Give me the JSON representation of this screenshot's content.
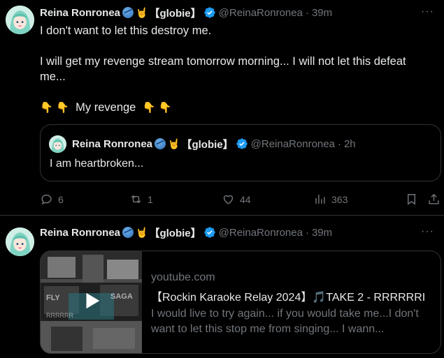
{
  "tweets": [
    {
      "author_name": "Reina Ronronea",
      "author_tag": "【globie】",
      "handle": "@ReinaRonronea",
      "time_sep": "·",
      "time": "39m",
      "text_lines": [
        "I don't want to let this destroy me.",
        "I will get my revenge stream tomorrow morning... I will not let this defeat",
        "me..."
      ],
      "revenge_text": "My revenge",
      "quote": {
        "author_name": "Reina Ronronea",
        "author_tag": "【globie】",
        "handle": "@ReinaRonronea",
        "time_sep": "·",
        "time": "2h",
        "text": "I am heartbroken..."
      },
      "actions": {
        "replies": "6",
        "retweets": "1",
        "likes": "44",
        "views": "363"
      }
    },
    {
      "author_name": "Reina Ronronea",
      "author_tag": "【globie】",
      "handle": "@ReinaRonronea",
      "time_sep": "·",
      "time": "39m",
      "card": {
        "domain": "youtube.com",
        "title": "【Rockin Karaoke Relay 2024】🎵TAKE 2 - RRRRRRI",
        "description": "I would live to try again... if you would take me...I don't want to let this stop me from singing... I wann..."
      }
    }
  ],
  "colors": {
    "background": "#000000",
    "text_primary": "#e7e9ea",
    "text_secondary": "#71767b",
    "border": "#2f3336",
    "verified": "#1d9bf0"
  },
  "icons": [
    "reply-icon",
    "retweet-icon",
    "like-icon",
    "views-icon",
    "bookmark-icon",
    "share-icon",
    "verified-icon",
    "more-icon",
    "play-icon"
  ]
}
